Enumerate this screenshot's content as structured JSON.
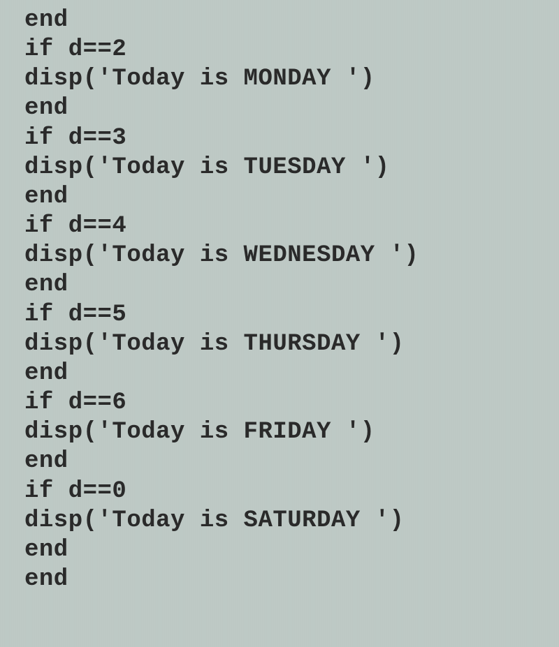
{
  "code": {
    "lines": [
      "end",
      "if d==2",
      "disp('Today is MONDAY ')",
      "end",
      "if d==3",
      "disp('Today is TUESDAY ')",
      "end",
      "if d==4",
      "disp('Today is WEDNESDAY ')",
      "end",
      "if d==5",
      "disp('Today is THURSDAY ')",
      "end",
      "if d==6",
      "disp('Today is FRIDAY ')",
      "end",
      "if d==0",
      "disp('Today is SATURDAY ')",
      "end",
      "end"
    ]
  }
}
